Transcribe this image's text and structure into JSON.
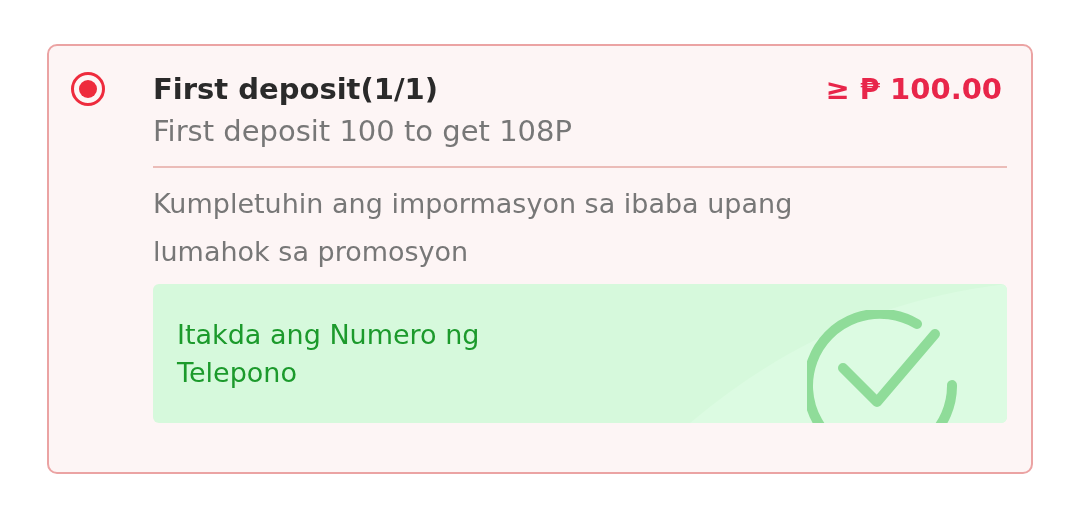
{
  "promo": {
    "selected": true,
    "title": "First deposit(1/1)",
    "amount": "≥ ₱ 100.00",
    "subtitle": "First deposit 100 to get 108P",
    "description": "Kumpletuhin ang impormasyon sa ibaba upang lumahok sa promosyon",
    "task": {
      "label": "Itakda ang Numero ng Telepono",
      "completed": true
    }
  }
}
